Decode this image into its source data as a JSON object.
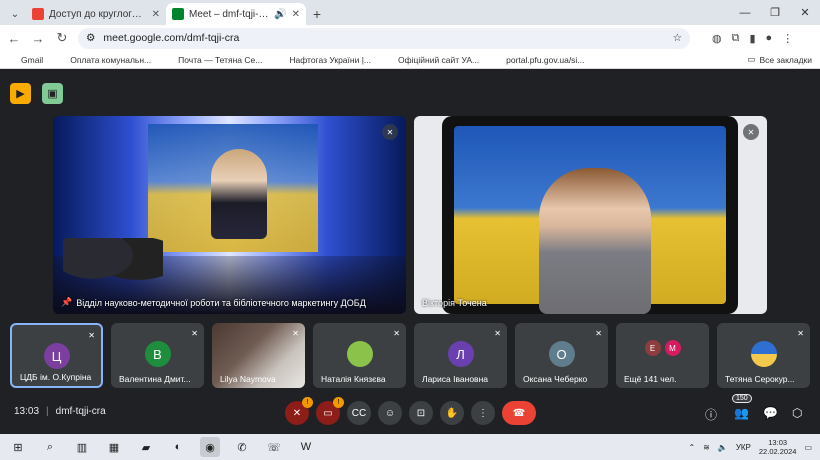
{
  "browser": {
    "tabs": [
      {
        "title": "Доступ до круглого столу «Не",
        "active": false,
        "icon": "gmail-icon",
        "color": "#ea4335"
      },
      {
        "title": "Meet – dmf-tqji-cra",
        "active": true,
        "icon": "meet-icon",
        "color": "#00832d"
      }
    ],
    "url": "meet.google.com/dmf-tqji-cra",
    "bookmarks": [
      {
        "label": "Gmail",
        "color": "#ea4335"
      },
      {
        "label": "Оплата комунальн...",
        "color": "#222222"
      },
      {
        "label": "Почта — Тетяна Се...",
        "color": "#0a64d8"
      },
      {
        "label": "Нафтогаз України |...",
        "color": "#1a1a1a"
      },
      {
        "label": "Офіційний сайт УА...",
        "color": "#f2b600"
      },
      {
        "label": "portal.pfu.gov.ua/si...",
        "color": "#6b8e23"
      }
    ],
    "all_bookmarks": "Все закладки"
  },
  "meet": {
    "main_tiles": [
      {
        "name": "Відділ науково-методичної роботи та бібліотечного маркетингу ДОБД",
        "pinned": true
      },
      {
        "name": "Вікторія Точена",
        "pinned": false
      }
    ],
    "participants": [
      {
        "name": "ЦДБ ім. О.Купріна",
        "initial": "Ц",
        "color": "#7b3fa0",
        "selected": true
      },
      {
        "name": "Валентина Дмит...",
        "initial": "В",
        "color": "#1e8e3e",
        "selected": false
      },
      {
        "name": "Lilya Naymova",
        "initial": "",
        "color": "",
        "selected": false,
        "photo": true
      },
      {
        "name": "Наталія Князєва",
        "initial": "",
        "color": "#8bc34a",
        "selected": false
      },
      {
        "name": "Лариса Івановна",
        "initial": "Л",
        "color": "#6a3fb0",
        "selected": false
      },
      {
        "name": "Оксана Чеберко",
        "initial": "О",
        "color": "#5f7d8c",
        "selected": false
      },
      {
        "name": "Ещё 141 чел.",
        "initial": "",
        "color": "",
        "selected": false,
        "others": [
          {
            "initial": "Е",
            "color": "#8d3d3d"
          },
          {
            "initial": "М",
            "color": "#d81b60"
          }
        ]
      },
      {
        "name": "Тетяна Серокур...",
        "initial": "",
        "color": "#f2c94c",
        "selected": false
      }
    ],
    "time": "13:03",
    "code": "dmf-tqji-cra",
    "people_count": "150"
  },
  "taskbar": {
    "lang": "УКР",
    "time": "13:03",
    "date": "22.02.2024"
  }
}
